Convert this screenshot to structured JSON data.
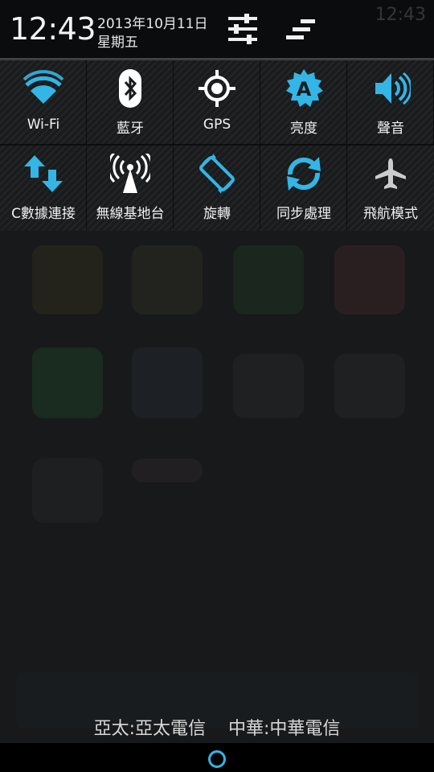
{
  "header": {
    "time": "12:43",
    "date": "2013年10月11日",
    "weekday": "星期五",
    "status_time_ghost": "12:43"
  },
  "quick_settings": {
    "row1": [
      {
        "label": "Wi-Fi",
        "icon": "wifi-icon",
        "color": "#33b5e5"
      },
      {
        "label": "藍牙",
        "icon": "bluetooth-icon",
        "color": "#ffffff"
      },
      {
        "label": "GPS",
        "icon": "gps-icon",
        "color": "#ffffff"
      },
      {
        "label": "亮度",
        "icon": "brightness-auto-icon",
        "color": "#33b5e5"
      },
      {
        "label": "聲音",
        "icon": "sound-icon",
        "color": "#33b5e5"
      }
    ],
    "row2": [
      {
        "label": "C數據連接",
        "icon": "mobile-data-icon",
        "color": "#33b5e5"
      },
      {
        "label": "無線基地台",
        "icon": "hotspot-icon",
        "color": "#ffffff"
      },
      {
        "label": "旋轉",
        "icon": "rotate-icon",
        "color": "#33b5e5"
      },
      {
        "label": "同步處理",
        "icon": "sync-icon",
        "color": "#33b5e5"
      },
      {
        "label": "飛航模式",
        "icon": "airplane-icon",
        "color": "#cccccc"
      }
    ]
  },
  "carriers": [
    "亞太:亞太電信",
    "中華:中華電信"
  ],
  "colors": {
    "accent": "#33b5e5",
    "panel": "#191b1d",
    "header": "#0b0c0d"
  }
}
